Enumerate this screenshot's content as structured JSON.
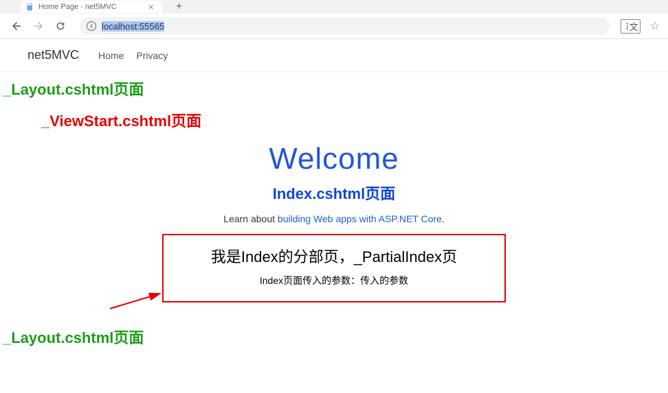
{
  "tab": {
    "title": "Home Page - net5MVC"
  },
  "address": {
    "url": "localhost:55565"
  },
  "navbar": {
    "brand": "net5MVC",
    "links": [
      "Home",
      "Privacy"
    ]
  },
  "layout_top": "_Layout.cshtml页面",
  "viewstart": "_ViewStart.cshtml页面",
  "welcome": "Welcome",
  "index_label": "Index.cshtml页面",
  "learn_prefix": "Learn about ",
  "learn_link": "building Web apps with ASP.NET Core",
  "learn_suffix": ".",
  "partial": {
    "title": "我是Index的分部页，_PartialIndex页",
    "param": "Index页面传入的参数：传入的参数"
  },
  "layout_bottom": "_Layout.cshtml页面"
}
